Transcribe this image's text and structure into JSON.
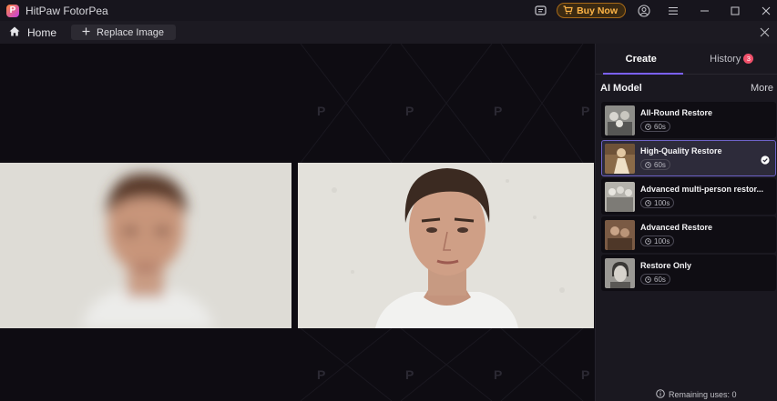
{
  "app": {
    "title": "HitPaw FotorPea",
    "logo_letter": "P"
  },
  "titlebar": {
    "buy_label": "Buy Now"
  },
  "toolbar": {
    "home_label": "Home",
    "replace_label": "Replace Image"
  },
  "canvas": {
    "watermark": "P"
  },
  "sidebar": {
    "tabs": [
      {
        "label": "Create",
        "active": true
      },
      {
        "label": "History",
        "badge": "3"
      }
    ],
    "section_title": "AI Model",
    "more_label": "More",
    "models": [
      {
        "name": "All-Round Restore",
        "duration": "60s",
        "selected": false
      },
      {
        "name": "High-Quality Restore",
        "duration": "60s",
        "selected": true
      },
      {
        "name": "Advanced multi-person restor...",
        "duration": "100s",
        "selected": false
      },
      {
        "name": "Advanced Restore",
        "duration": "100s",
        "selected": false
      },
      {
        "name": "Restore Only",
        "duration": "60s",
        "selected": false
      }
    ],
    "remaining": "Remaining uses: 0"
  },
  "colors": {
    "accent": "#7b61ff",
    "buy": "#ffb547",
    "badge": "#f0506a",
    "background": "#0f0d14"
  },
  "icons": [
    "logo-icon",
    "feedback-icon",
    "cart-icon",
    "account-icon",
    "menu-icon",
    "minimize-icon",
    "maximize-icon",
    "close-icon",
    "home-icon",
    "plus-icon",
    "clock-icon",
    "check-icon",
    "info-icon"
  ]
}
